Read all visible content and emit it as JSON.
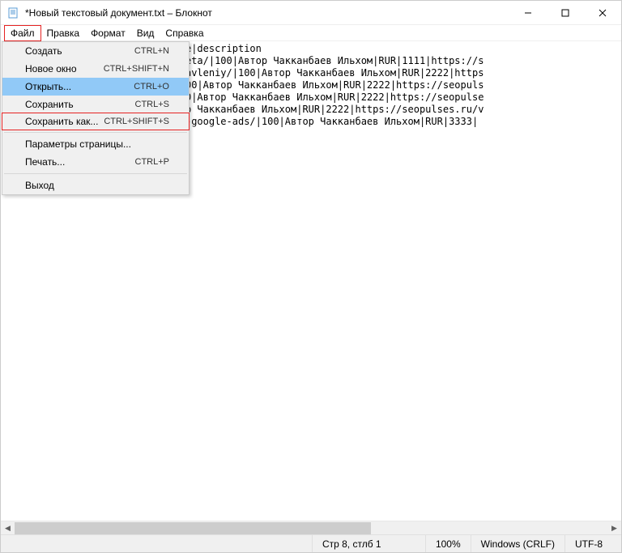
{
  "title": "*Новый текстовый документ.txt – Блокнот",
  "menubar": {
    "file": "Файл",
    "edit": "Правка",
    "format": "Формат",
    "view": "Вид",
    "help": "Справка"
  },
  "dropdown": {
    "create": {
      "label": "Создать",
      "shortcut": "CTRL+N"
    },
    "newwin": {
      "label": "Новое окно",
      "shortcut": "CTRL+SHIFT+N"
    },
    "open": {
      "label": "Открыть...",
      "shortcut": "CTRL+O"
    },
    "save": {
      "label": "Сохранить",
      "shortcut": "CTRL+S"
    },
    "saveas": {
      "label": "Сохранить как...",
      "shortcut": "CTRL+SHIFT+S"
    },
    "pagesetup": {
      "label": "Параметры страницы..."
    },
    "print": {
      "label": "Печать...",
      "shortcut": "CTRL+P"
    },
    "exit": {
      "label": "Выход"
    }
  },
  "text": {
    "l1": "rrencyid|categoryid|picture|name|description",
    "l2": "dat-price-list-dlya-yandex-marketa/|100|Автор Чакканбаев Ильхом|RUR|1111|https://s",
    "l3": "dat-feed-dlya-dinamicheskih-obyavleniy/|100|Автор Чакканбаев Ильхом|RUR|2222|https",
    "l4": "dat-feed-dlya-smart-bannerov/|100|Автор Чакканбаев Ильхом|RUR|2222|https://seopuls",
    "l5": "ya-galereya-v-yandex-direct/|100|Автор Чакканбаев Ильхом|RUR|2222|https://seopulse",
    "l6": "nneri-v-yandex-direct/|100|Автор Чакканбаев Ильхом|RUR|2222|https://seopulses.ru/v",
    "l7": "heskiye-poickovye-obyavleniya-v-google-ads/|100|Автор Чакканбаев Ильхом|RUR|3333|"
  },
  "statusbar": {
    "pos": "Стр 8, стлб 1",
    "zoom": "100%",
    "eol": "Windows (CRLF)",
    "enc": "UTF-8"
  }
}
